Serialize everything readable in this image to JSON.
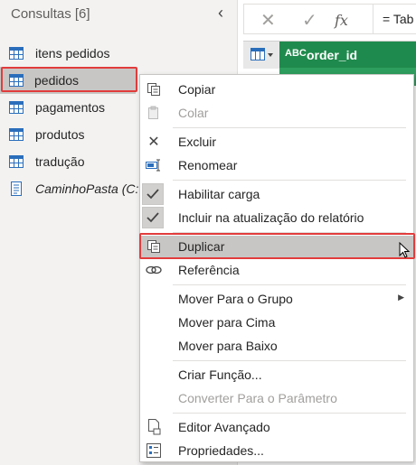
{
  "queries_pane": {
    "header": "Consultas [6]",
    "items": [
      {
        "label": "itens pedidos",
        "icon": "table-icon"
      },
      {
        "label": "pedidos",
        "icon": "table-icon",
        "selected": true
      },
      {
        "label": "pagamentos",
        "icon": "table-icon"
      },
      {
        "label": "produtos",
        "icon": "table-icon"
      },
      {
        "label": "tradução",
        "icon": "table-icon"
      },
      {
        "label": "CaminhoPasta (C:",
        "icon": "parameter-icon"
      }
    ]
  },
  "formula_bar": {
    "cancel_icon": "✕",
    "confirm_icon": "✓",
    "fx_label": "fx",
    "formula_text": "= Tab"
  },
  "grid": {
    "type_icon_label": "ABC",
    "column_name": "order_id"
  },
  "context_menu": {
    "items": [
      {
        "label": "Copiar",
        "icon": "copy-icon",
        "enabled": true
      },
      {
        "label": "Colar",
        "icon": "paste-icon",
        "enabled": false
      },
      {
        "label": "Excluir",
        "icon": "delete-icon",
        "enabled": true
      },
      {
        "label": "Renomear",
        "icon": "rename-icon",
        "enabled": true
      },
      {
        "label": "Habilitar carga",
        "icon": "check-icon",
        "checked": true
      },
      {
        "label": "Incluir na atualização do relatório",
        "icon": "check-icon",
        "checked": true
      },
      {
        "label": "Duplicar",
        "icon": "duplicate-icon",
        "highlighted": true
      },
      {
        "label": "Referência",
        "icon": "reference-icon",
        "enabled": true
      },
      {
        "label": "Mover Para o Grupo",
        "icon": "",
        "has_submenu": true
      },
      {
        "label": "Mover para Cima",
        "icon": ""
      },
      {
        "label": "Mover para Baixo",
        "icon": ""
      },
      {
        "label": "Criar Função...",
        "icon": ""
      },
      {
        "label": "Converter Para o Parâmetro",
        "icon": "",
        "enabled": false
      },
      {
        "label": "Editor Avançado",
        "icon": "advanced-editor-icon"
      },
      {
        "label": "Propriedades...",
        "icon": "properties-icon"
      }
    ]
  },
  "colors": {
    "highlight_outline": "#e23c3c",
    "column_header_green": "#1f8a4d",
    "table_icon_blue": "#2a6ebb"
  }
}
